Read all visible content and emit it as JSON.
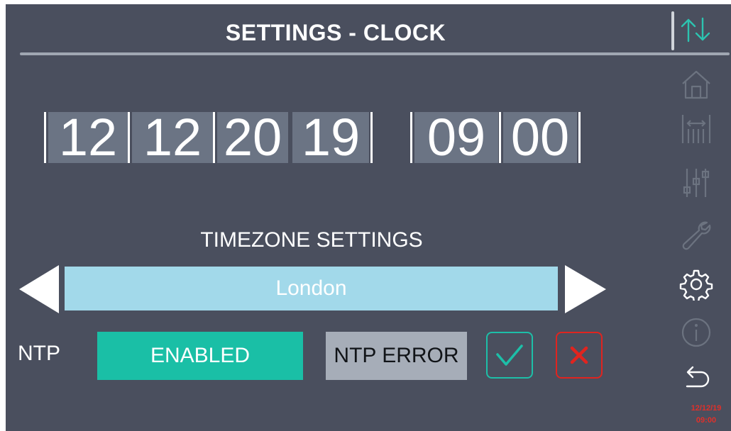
{
  "header": {
    "title": "SETTINGS - CLOCK"
  },
  "datetime": {
    "day": "12",
    "month": "12",
    "year_century": "20",
    "year_short": "19",
    "hour": "09",
    "minute": "00"
  },
  "timezone": {
    "title": "TIMEZONE SETTINGS",
    "value": "London"
  },
  "ntp": {
    "label": "NTP",
    "status": "ENABLED",
    "error": "NTP ERROR"
  },
  "sidebar": {
    "items": [
      {
        "icon": "home-icon"
      },
      {
        "icon": "gauge-icon"
      },
      {
        "icon": "sliders-icon"
      },
      {
        "icon": "wrench-icon"
      },
      {
        "icon": "gear-icon",
        "active": true
      },
      {
        "icon": "info-icon"
      },
      {
        "icon": "back-icon"
      }
    ],
    "date": "12/12/19",
    "time": "09:00"
  },
  "colors": {
    "background": "#4a4f5e",
    "timezone_box": "#a2d9ea",
    "enabled": "#1abfa6",
    "error_box": "#a6adb8",
    "confirm": "#1dbfa8",
    "cancel": "#e0241f",
    "sync_icon": "#2cc3b0",
    "inactive_icon": "#6c7380"
  }
}
